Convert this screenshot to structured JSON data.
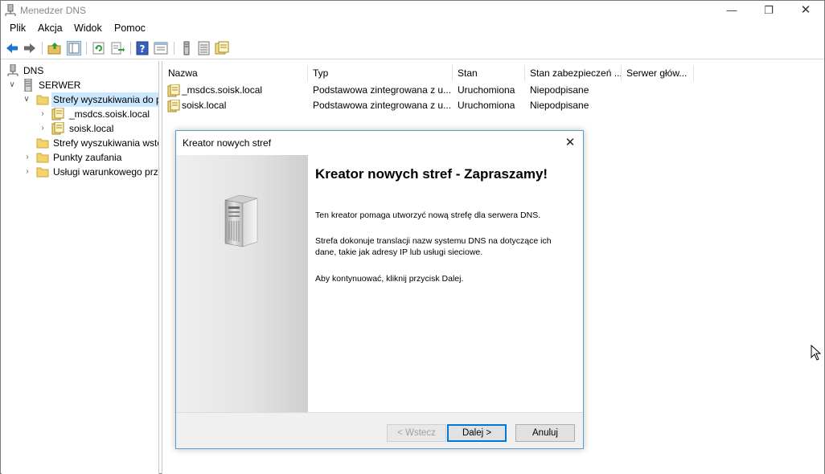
{
  "window": {
    "title": "Menedzer DNS",
    "minimize": "—",
    "maximize": "❐",
    "close": "✕"
  },
  "menu": [
    "Plik",
    "Akcja",
    "Widok",
    "Pomoc"
  ],
  "tree": {
    "root": "DNS",
    "server": "SERWER",
    "forward_zones": "Strefy wyszukiwania do p",
    "zone_msdcs": "_msdcs.soisk.local",
    "zone_soisk": "soisk.local",
    "reverse_zones": "Strefy wyszukiwania wste",
    "trust_points": "Punkty zaufania",
    "conditional_forwarders": "Usługi warunkowego prz"
  },
  "list": {
    "columns": [
      "Nazwa",
      "Typ",
      "Stan",
      "Stan zabezpieczeń ...",
      "Serwer głów..."
    ],
    "rows": [
      {
        "name": "_msdcs.soisk.local",
        "type": "Podstawowa zintegrowana z u...",
        "status": "Uruchomiona",
        "security": "Niepodpisane"
      },
      {
        "name": "soisk.local",
        "type": "Podstawowa zintegrowana z u...",
        "status": "Uruchomiona",
        "security": "Niepodpisane"
      }
    ]
  },
  "dialog": {
    "title": "Kreator nowych stref",
    "close": "✕",
    "heading": "Kreator nowych stref - Zapraszamy!",
    "para1": "Ten kreator pomaga utworzyć nową strefę dla serwera DNS.",
    "para2": "Strefa dokonuje translacji nazw systemu DNS na dotyczące ich dane, takie jak adresy IP lub usługi sieciowe.",
    "para3": "Aby kontynuować, kliknij przycisk Dalej.",
    "back_label": "< Wstecz",
    "next_label": "Dalej >",
    "cancel_label": "Anuluj"
  },
  "tree_chevrons": {
    "expanded": "∨",
    "collapsed": "›"
  },
  "colors": {
    "selection": "#cce8ff",
    "accent": "#0078d7",
    "dialog_border": "#5a9fd4"
  }
}
